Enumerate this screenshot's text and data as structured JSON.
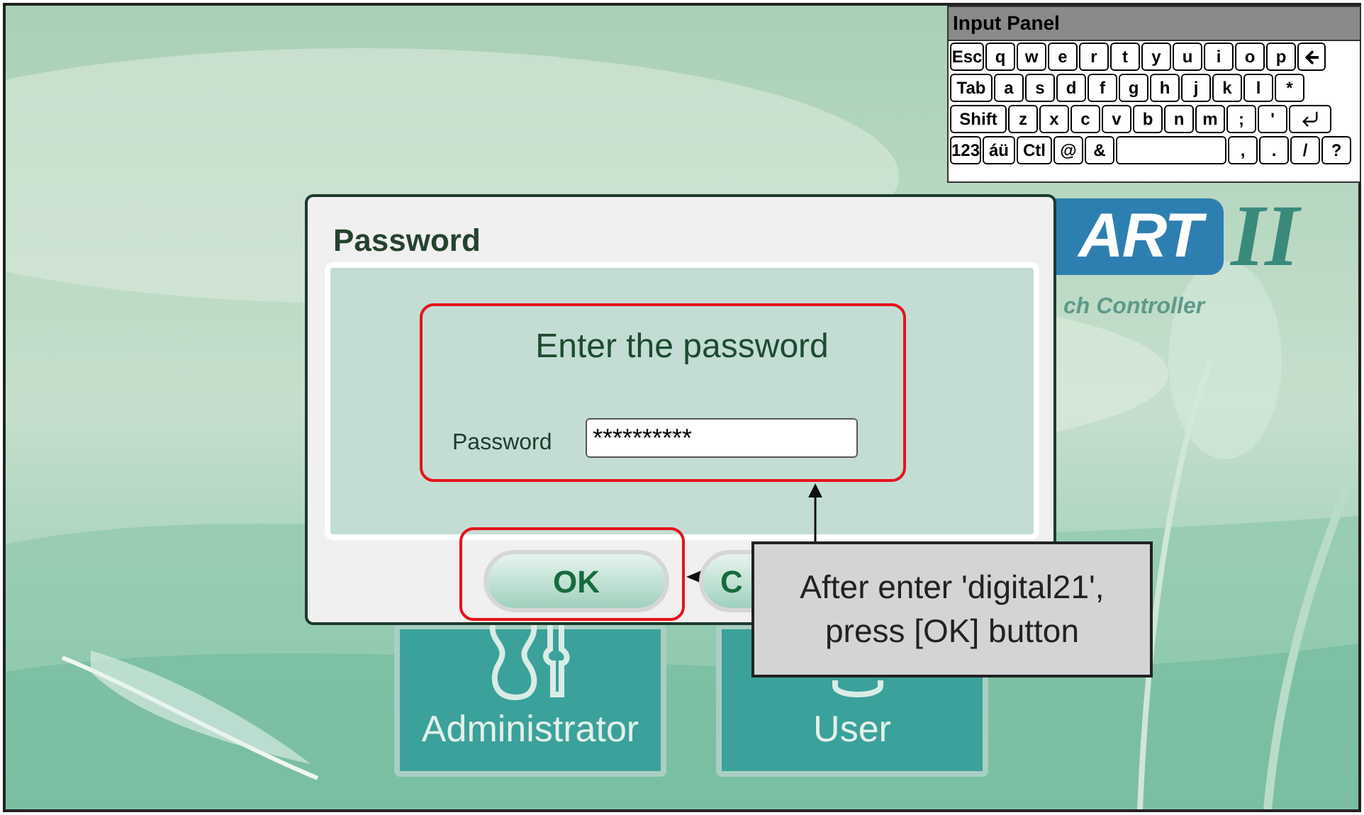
{
  "logo": {
    "wordmark": "ART",
    "numeral": "II",
    "subtitle": "ch Controller"
  },
  "tiles": [
    {
      "kind": "admin",
      "label": "Administrator"
    },
    {
      "kind": "user",
      "label": "User"
    }
  ],
  "input_panel": {
    "title": "Input Panel",
    "rows": [
      [
        {
          "kind": "key",
          "label": "Esc"
        },
        {
          "kind": "key",
          "label": "q"
        },
        {
          "kind": "key",
          "label": "w"
        },
        {
          "kind": "key",
          "label": "e"
        },
        {
          "kind": "key",
          "label": "r"
        },
        {
          "kind": "key",
          "label": "t"
        },
        {
          "kind": "key",
          "label": "y"
        },
        {
          "kind": "key",
          "label": "u"
        },
        {
          "kind": "key",
          "label": "i"
        },
        {
          "kind": "key",
          "label": "o"
        },
        {
          "kind": "key",
          "label": "p"
        },
        {
          "kind": "backspace"
        }
      ],
      [
        {
          "kind": "key",
          "label": "Tab"
        },
        {
          "kind": "key",
          "label": "a"
        },
        {
          "kind": "key",
          "label": "s"
        },
        {
          "kind": "key",
          "label": "d"
        },
        {
          "kind": "key",
          "label": "f"
        },
        {
          "kind": "key",
          "label": "g"
        },
        {
          "kind": "key",
          "label": "h"
        },
        {
          "kind": "key",
          "label": "j"
        },
        {
          "kind": "key",
          "label": "k"
        },
        {
          "kind": "key",
          "label": "l"
        },
        {
          "kind": "key",
          "label": "*"
        }
      ],
      [
        {
          "kind": "key",
          "label": "Shift"
        },
        {
          "kind": "key",
          "label": "z"
        },
        {
          "kind": "key",
          "label": "x"
        },
        {
          "kind": "key",
          "label": "c"
        },
        {
          "kind": "key",
          "label": "v"
        },
        {
          "kind": "key",
          "label": "b"
        },
        {
          "kind": "key",
          "label": "n"
        },
        {
          "kind": "key",
          "label": "m"
        },
        {
          "kind": "key",
          "label": ";"
        },
        {
          "kind": "key",
          "label": "'"
        },
        {
          "kind": "enter"
        }
      ],
      [
        {
          "kind": "key",
          "label": "123"
        },
        {
          "kind": "key",
          "label": "áü"
        },
        {
          "kind": "key",
          "label": "Ctl"
        },
        {
          "kind": "key",
          "label": "@"
        },
        {
          "kind": "key",
          "label": "&"
        },
        {
          "kind": "space"
        },
        {
          "kind": "key",
          "label": ","
        },
        {
          "kind": "key",
          "label": "."
        },
        {
          "kind": "key",
          "label": "/"
        },
        {
          "kind": "key",
          "label": "?"
        }
      ]
    ]
  },
  "dialog": {
    "title": "Password",
    "heading": "Enter the password",
    "field_label": "Password",
    "field_value": "**********",
    "buttons": [
      {
        "label": "OK"
      },
      {
        "label": "C"
      }
    ]
  },
  "callout": {
    "text": "After enter 'digital21', press [OK] button"
  }
}
